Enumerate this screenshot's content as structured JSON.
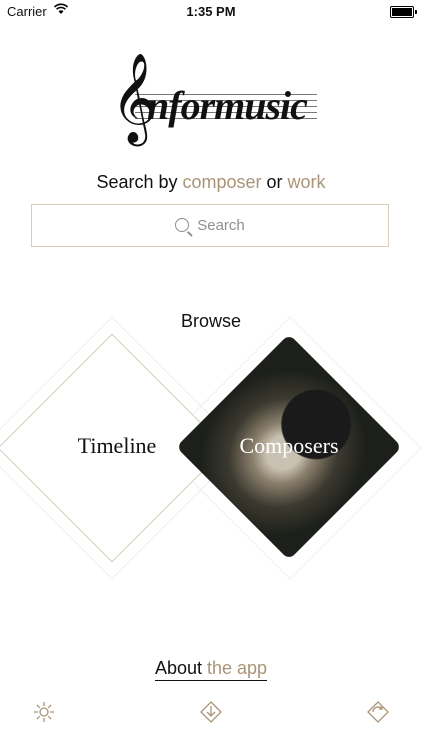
{
  "status_bar": {
    "carrier": "Carrier",
    "time": "1:35 PM"
  },
  "logo": {
    "text": "nformusic"
  },
  "search": {
    "prompt": {
      "prefix": "Search by ",
      "composer": "composer",
      "connector": " or ",
      "work": "work"
    },
    "placeholder": "Search"
  },
  "browse": {
    "title": "Browse",
    "timeline_label": "Timeline",
    "composers_label": "Composers"
  },
  "about": {
    "prefix": "About ",
    "accent": "the app"
  },
  "toolbar": {
    "icons": [
      "settings-icon",
      "download-icon",
      "rotate-icon"
    ]
  },
  "colors": {
    "accent": "#a99477",
    "border": "#d8cdb9"
  }
}
